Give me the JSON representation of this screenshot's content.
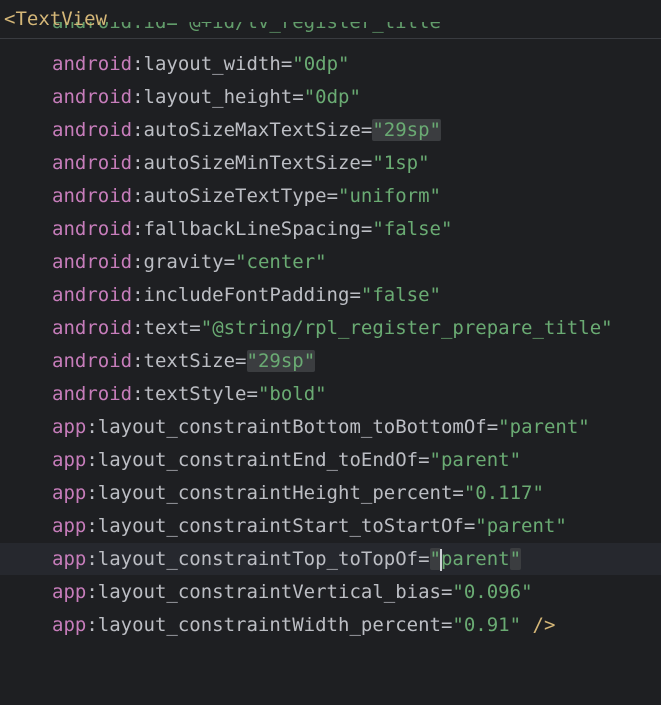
{
  "header": {
    "open_tag": "<TextView",
    "peek_text": "android:id=\"@+id/tv_register_title\""
  },
  "lines": [
    {
      "ns": "android",
      "attr": "layout_width",
      "value": "0dp"
    },
    {
      "ns": "android",
      "attr": "layout_height",
      "value": "0dp"
    },
    {
      "ns": "android",
      "attr": "autoSizeMaxTextSize",
      "value": "29sp"
    },
    {
      "ns": "android",
      "attr": "autoSizeMinTextSize",
      "value": "1sp"
    },
    {
      "ns": "android",
      "attr": "autoSizeTextType",
      "value": "uniform"
    },
    {
      "ns": "android",
      "attr": "fallbackLineSpacing",
      "value": "false"
    },
    {
      "ns": "android",
      "attr": "gravity",
      "value": "center"
    },
    {
      "ns": "android",
      "attr": "includeFontPadding",
      "value": "false"
    },
    {
      "ns": "android",
      "attr": "text",
      "value": "@string/rpl_register_prepare_title"
    },
    {
      "ns": "android",
      "attr": "textSize",
      "value": "29sp"
    },
    {
      "ns": "android",
      "attr": "textStyle",
      "value": "bold"
    },
    {
      "ns": "app",
      "attr": "layout_constraintBottom_toBottomOf",
      "value": "parent"
    },
    {
      "ns": "app",
      "attr": "layout_constraintEnd_toEndOf",
      "value": "parent"
    },
    {
      "ns": "app",
      "attr": "layout_constraintHeight_percent",
      "value": "0.117"
    },
    {
      "ns": "app",
      "attr": "layout_constraintStart_toStartOf",
      "value": "parent"
    },
    {
      "ns": "app",
      "attr": "layout_constraintTop_toTopOf",
      "value": "parent"
    },
    {
      "ns": "app",
      "attr": "layout_constraintVertical_bias",
      "value": "0.096"
    },
    {
      "ns": "app",
      "attr": "layout_constraintWidth_percent",
      "value": "0.91"
    }
  ],
  "closing": "/>",
  "colors": {
    "background": "#1e1f22",
    "namespace": "#c77dbb",
    "attribute": "#bcbec4",
    "string_value": "#6aab73",
    "tag": "#d5b778",
    "highlight": "#3b3d40",
    "current_line": "#26282e"
  }
}
